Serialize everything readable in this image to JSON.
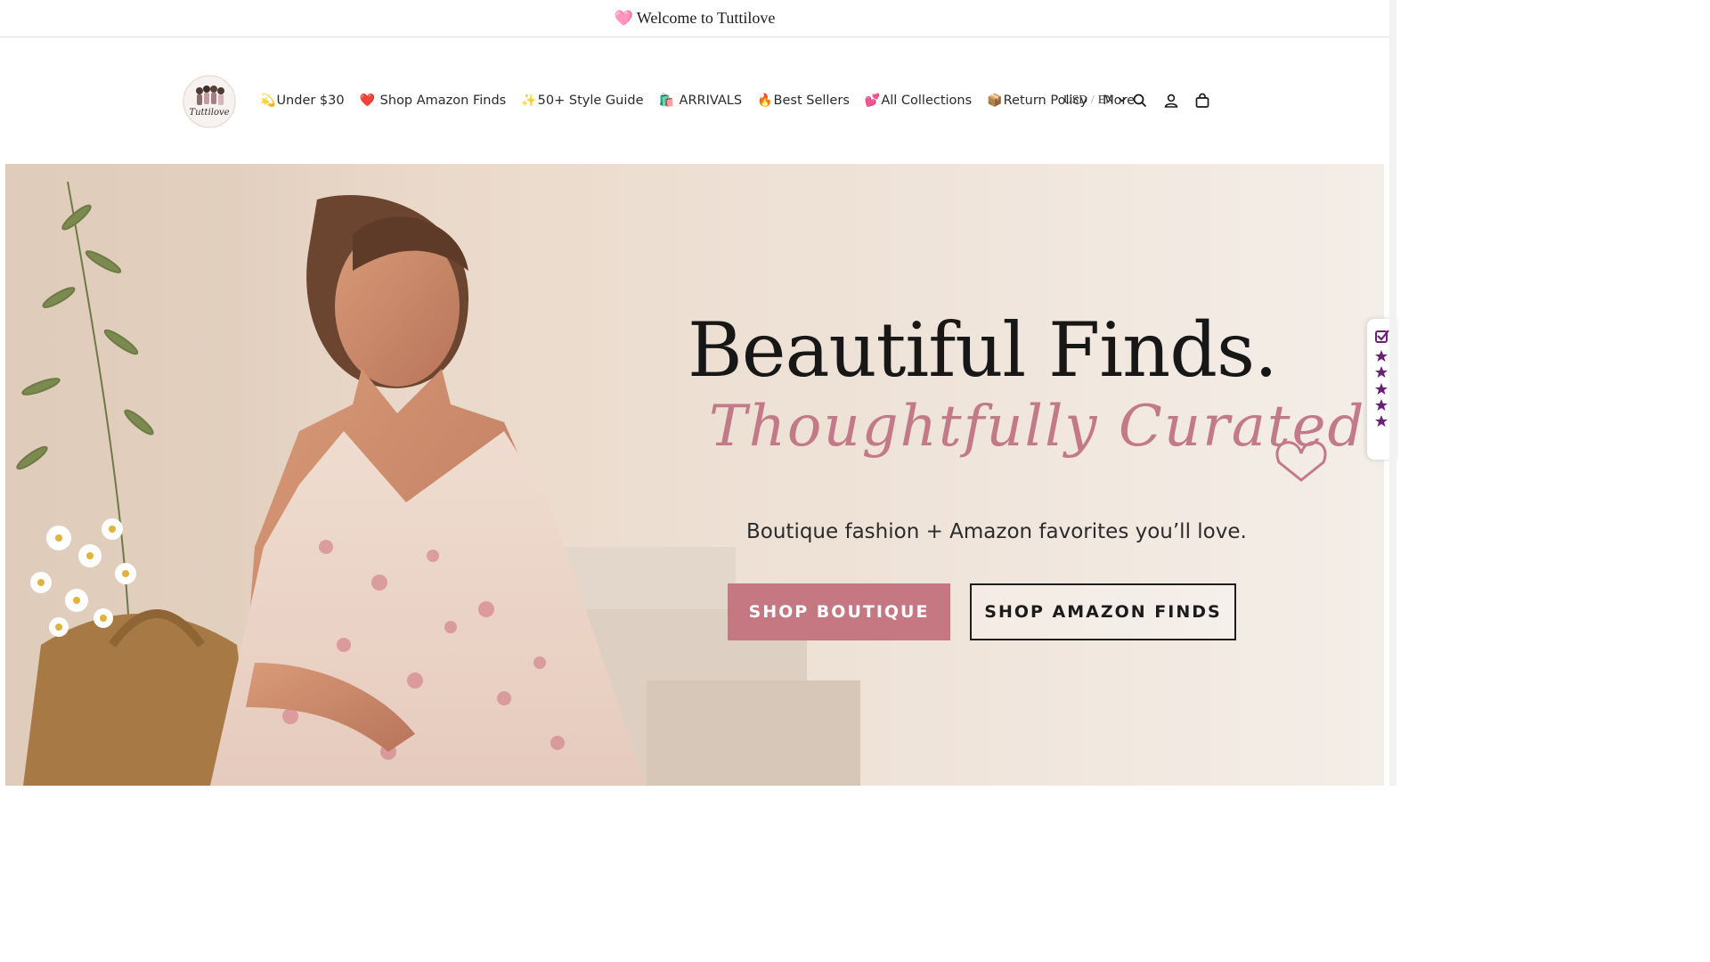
{
  "announcement": {
    "heart_icon": "pink-heart-emoji",
    "text": "Welcome to Tuttilove"
  },
  "header": {
    "logo_alt": "Tuttilove",
    "nav": [
      {
        "emoji": "💫",
        "label": "Under $30"
      },
      {
        "emoji": "❤️",
        "label": " Shop Amazon Finds"
      },
      {
        "emoji": "✨",
        "label": "50+ Style Guide"
      },
      {
        "emoji": "🛍️",
        "label": " ARRIVALS"
      },
      {
        "emoji": "🔥",
        "label": "Best Sellers"
      },
      {
        "emoji": "💕",
        "label": "All Collections"
      },
      {
        "emoji": "📦",
        "label": "Return Policy"
      },
      {
        "emoji": "",
        "label": "More"
      }
    ],
    "locale": {
      "currency": "USD",
      "separator": "/",
      "language": "EN"
    },
    "icons": [
      "search-icon",
      "account-icon",
      "cart-icon"
    ]
  },
  "hero": {
    "title": "Beautiful Finds.",
    "script": "Thoughtfully Curated.",
    "subtitle": "Boutique fashion + Amazon favorites you’ll love.",
    "primary_button": "SHOP BOUTIQUE",
    "secondary_button": "SHOP AMAZON FINDS"
  },
  "reviews_tab": {
    "icon": "verified-check-icon",
    "stars": 5,
    "color": "#6b1f7a"
  },
  "colors": {
    "accent_pink": "#c57882",
    "script_pink": "#c27a88",
    "star_purple": "#6b1f7a"
  }
}
